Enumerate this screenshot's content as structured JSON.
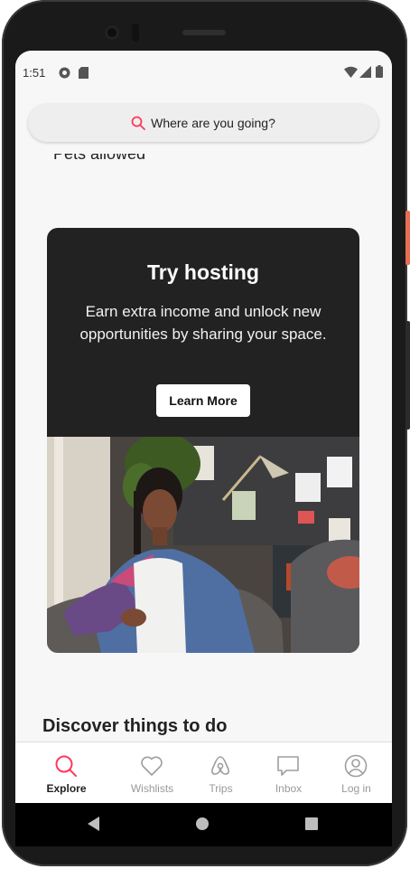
{
  "status_bar": {
    "time": "1:51",
    "icons": [
      "pocket-icon",
      "sd-card-icon",
      "wifi-icon",
      "signal-icon",
      "battery-icon"
    ]
  },
  "search": {
    "icon": "search-icon",
    "placeholder": "Where are you going?"
  },
  "partial_row": {
    "text": "Pets allowed"
  },
  "hosting_card": {
    "title": "Try hosting",
    "body": "Earn extra income and unlock new opportunities by sharing your space.",
    "button_label": "Learn More",
    "photo": "woman-sitting-on-sofa-in-living-room-photo"
  },
  "section_heading": "Discover things to do",
  "tab_bar": {
    "tabs": [
      {
        "label": "Explore",
        "icon": "search-icon",
        "active": true
      },
      {
        "label": "Wishlists",
        "icon": "heart-icon",
        "active": false
      },
      {
        "label": "Trips",
        "icon": "airbnb-logo-icon",
        "active": false
      },
      {
        "label": "Inbox",
        "icon": "message-icon",
        "active": false
      },
      {
        "label": "Log in",
        "icon": "user-circle-icon",
        "active": false
      }
    ]
  },
  "colors": {
    "accent": "#ff385c",
    "card_bg": "#222222",
    "screen_bg": "#f7f7f7",
    "inactive": "#999999"
  }
}
